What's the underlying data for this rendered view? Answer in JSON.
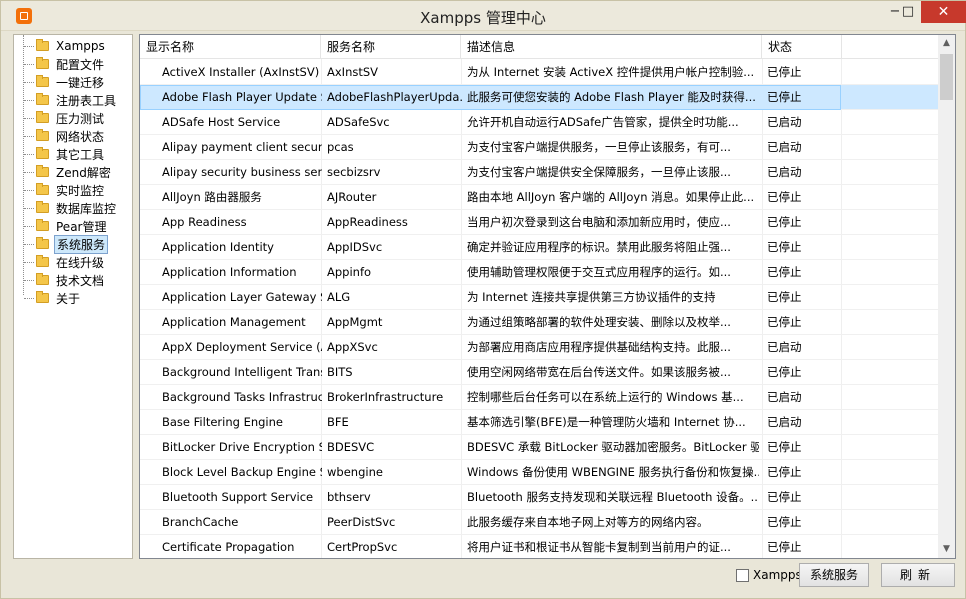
{
  "window": {
    "title": "Xampps 管理中心",
    "min_glyph": "−",
    "max_glyph": "□",
    "close_glyph": "✕"
  },
  "tree": {
    "items": [
      {
        "label": "Xampps"
      },
      {
        "label": "配置文件"
      },
      {
        "label": "一键迁移"
      },
      {
        "label": "注册表工具"
      },
      {
        "label": "压力测试"
      },
      {
        "label": "网络状态"
      },
      {
        "label": "其它工具"
      },
      {
        "label": "Zend解密"
      },
      {
        "label": "实时监控"
      },
      {
        "label": "数据库监控"
      },
      {
        "label": "Pear管理"
      },
      {
        "label": "系统服务"
      },
      {
        "label": "在线升级"
      },
      {
        "label": "技术文档"
      },
      {
        "label": "关于"
      }
    ],
    "selected_index": 11
  },
  "table": {
    "columns": [
      "显示名称",
      "服务名称",
      "描述信息",
      "状态"
    ],
    "rows": [
      {
        "name": "ActiveX Installer (AxInstSV)",
        "service": "AxInstSV",
        "desc": "为从 Internet 安装 ActiveX 控件提供用户帐户控制验...",
        "status": "已停止"
      },
      {
        "name": "Adobe Flash Player Update S...",
        "service": "AdobeFlashPlayerUpda...",
        "desc": "此服务可使您安装的 Adobe Flash Player 能及时获得...",
        "status": "已停止"
      },
      {
        "name": "ADSafe Host Service",
        "service": "ADSafeSvc",
        "desc": "允许开机自动运行ADSafe广告管家，提供全时功能...",
        "status": "已启动"
      },
      {
        "name": "Alipay payment client securit...",
        "service": "pcas",
        "desc": "为支付宝客户端提供服务，一旦停止该服务，有可...",
        "status": "已启动"
      },
      {
        "name": "Alipay security business service",
        "service": "secbizsrv",
        "desc": "为支付宝客户端提供安全保障服务，一旦停止该服...",
        "status": "已启动"
      },
      {
        "name": "AllJoyn 路由器服务",
        "service": "AJRouter",
        "desc": "路由本地 AllJoyn 客户端的 AllJoyn 消息。如果停止此...",
        "status": "已停止"
      },
      {
        "name": "App Readiness",
        "service": "AppReadiness",
        "desc": "当用户初次登录到这台电脑和添加新应用时，使应...",
        "status": "已停止"
      },
      {
        "name": "Application Identity",
        "service": "AppIDSvc",
        "desc": "确定并验证应用程序的标识。禁用此服务将阻止强...",
        "status": "已停止"
      },
      {
        "name": "Application Information",
        "service": "Appinfo",
        "desc": "使用辅助管理权限便于交互式应用程序的运行。如...",
        "status": "已停止"
      },
      {
        "name": "Application Layer Gateway S...",
        "service": "ALG",
        "desc": "为 Internet 连接共享提供第三方协议插件的支持",
        "status": "已停止"
      },
      {
        "name": "Application Management",
        "service": "AppMgmt",
        "desc": "为通过组策略部署的软件处理安装、删除以及枚举...",
        "status": "已停止"
      },
      {
        "name": "AppX Deployment Service (A...",
        "service": "AppXSvc",
        "desc": "为部署应用商店应用程序提供基础结构支持。此服...",
        "status": "已启动"
      },
      {
        "name": "Background Intelligent Transf...",
        "service": "BITS",
        "desc": "使用空闲网络带宽在后台传送文件。如果该服务被...",
        "status": "已停止"
      },
      {
        "name": "Background Tasks Infrastruct...",
        "service": "BrokerInfrastructure",
        "desc": "控制哪些后台任务可以在系统上运行的 Windows 基...",
        "status": "已启动"
      },
      {
        "name": "Base Filtering Engine",
        "service": "BFE",
        "desc": "基本筛选引擎(BFE)是一种管理防火墙和 Internet 协...",
        "status": "已启动"
      },
      {
        "name": "BitLocker Drive Encryption Se...",
        "service": "BDESVC",
        "desc": "BDESVC 承载 BitLocker 驱动器加密服务。BitLocker 驱...",
        "status": "已停止"
      },
      {
        "name": "Block Level Backup Engine Se...",
        "service": "wbengine",
        "desc": "Windows 备份使用 WBENGINE 服务执行备份和恢复操...",
        "status": "已停止"
      },
      {
        "name": "Bluetooth Support Service",
        "service": "bthserv",
        "desc": "Bluetooth 服务支持发现和关联远程 Bluetooth 设备。...",
        "status": "已停止"
      },
      {
        "name": "BranchCache",
        "service": "PeerDistSvc",
        "desc": "此服务缓存来自本地子网上对等方的网络内容。",
        "status": "已停止"
      },
      {
        "name": "Certificate Propagation",
        "service": "CertPropSvc",
        "desc": "将用户证书和根证书从智能卡复制到当前用户的证...",
        "status": "已停止"
      }
    ],
    "selected_row": 1
  },
  "footer": {
    "checkbox_label": "Xampps",
    "checkbox_checked": false,
    "services_button": "系统服务",
    "refresh_button": "刷新"
  }
}
